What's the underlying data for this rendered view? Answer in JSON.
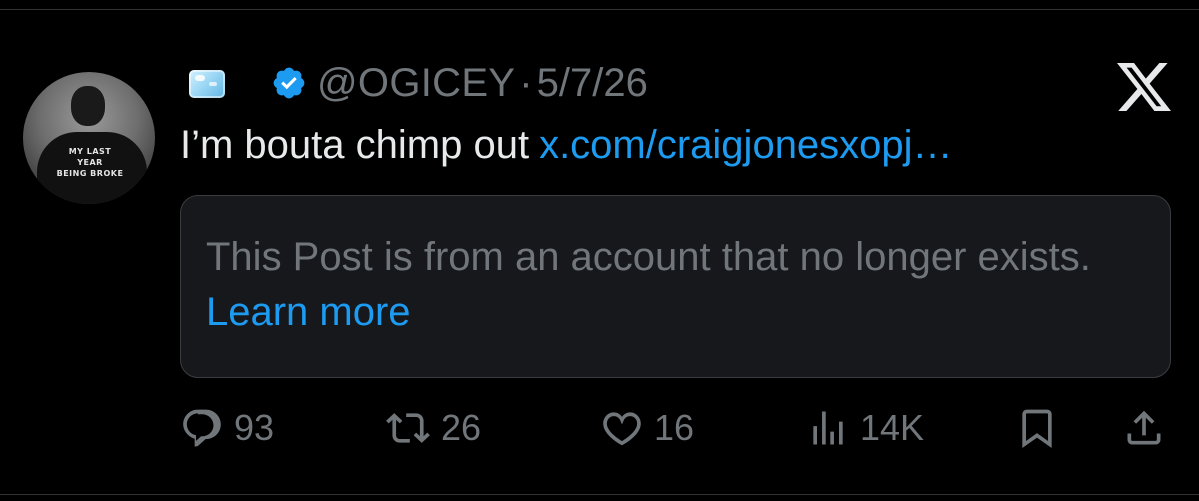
{
  "post": {
    "handle": "@OGICEY",
    "separator": "·",
    "date": "5/7/26",
    "display_emoji": "ice-cube",
    "verified_color": "#1d9bf0",
    "text": "I’m bouta chimp out",
    "link": "x.com/craigjonesxopj…",
    "avatar_shirt": [
      "MY LAST",
      "YEAR",
      "BEING BROKE"
    ]
  },
  "quote": {
    "message": "This Post is from an account that no longer exists.",
    "learn_more": "Learn more"
  },
  "actions": {
    "replies": "93",
    "reposts": "26",
    "likes": "16",
    "views": "14K"
  },
  "colors": {
    "background": "#000000",
    "text_primary": "#e7e9ea",
    "text_secondary": "#71767b",
    "accent": "#1d9bf0",
    "card_bg": "#16181c",
    "border": "#3a3d40"
  }
}
